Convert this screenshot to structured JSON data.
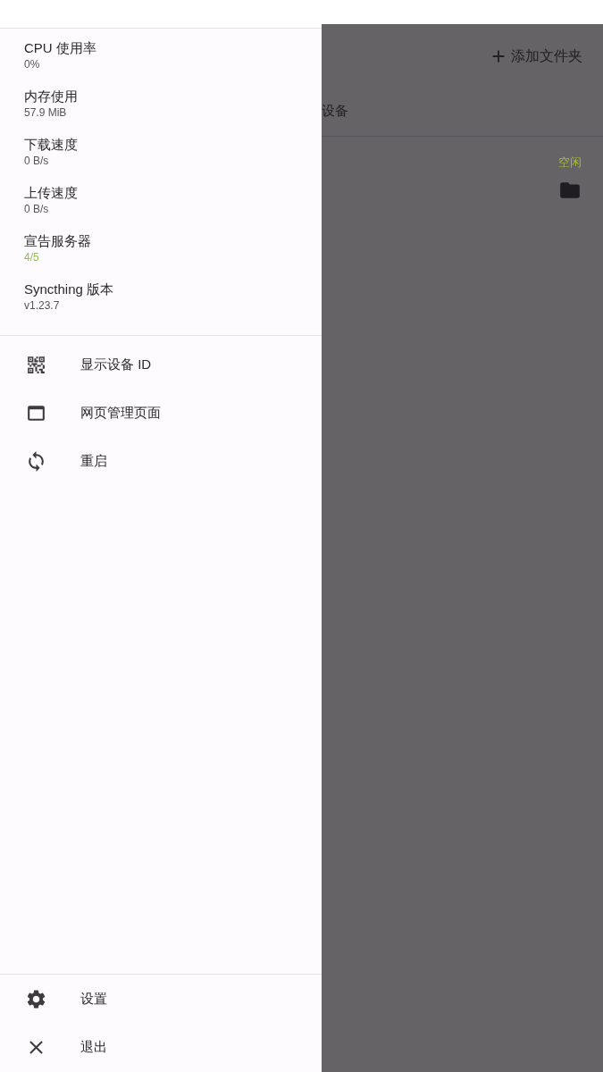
{
  "drawer": {
    "stats": [
      {
        "label": "CPU 使用率",
        "value": "0%",
        "highlight": false
      },
      {
        "label": "内存使用",
        "value": "57.9 MiB",
        "highlight": false
      },
      {
        "label": "下载速度",
        "value": "0 B/s",
        "highlight": false
      },
      {
        "label": "上传速度",
        "value": "0 B/s",
        "highlight": false
      },
      {
        "label": "宣告服务器",
        "value": "4/5",
        "highlight": true
      },
      {
        "label": "Syncthing 版本",
        "value": "v1.23.7",
        "highlight": false
      }
    ],
    "menu": [
      {
        "kind": "qr",
        "label": "显示设备 ID"
      },
      {
        "kind": "web",
        "label": "网页管理页面"
      },
      {
        "kind": "restart",
        "label": "重启"
      }
    ],
    "footer_menu": [
      {
        "kind": "settings",
        "label": "设置"
      },
      {
        "kind": "exit",
        "label": "退出"
      }
    ]
  },
  "background": {
    "add_folder": "添加文件夹",
    "tab": "设备",
    "folder_status": "空闲"
  }
}
